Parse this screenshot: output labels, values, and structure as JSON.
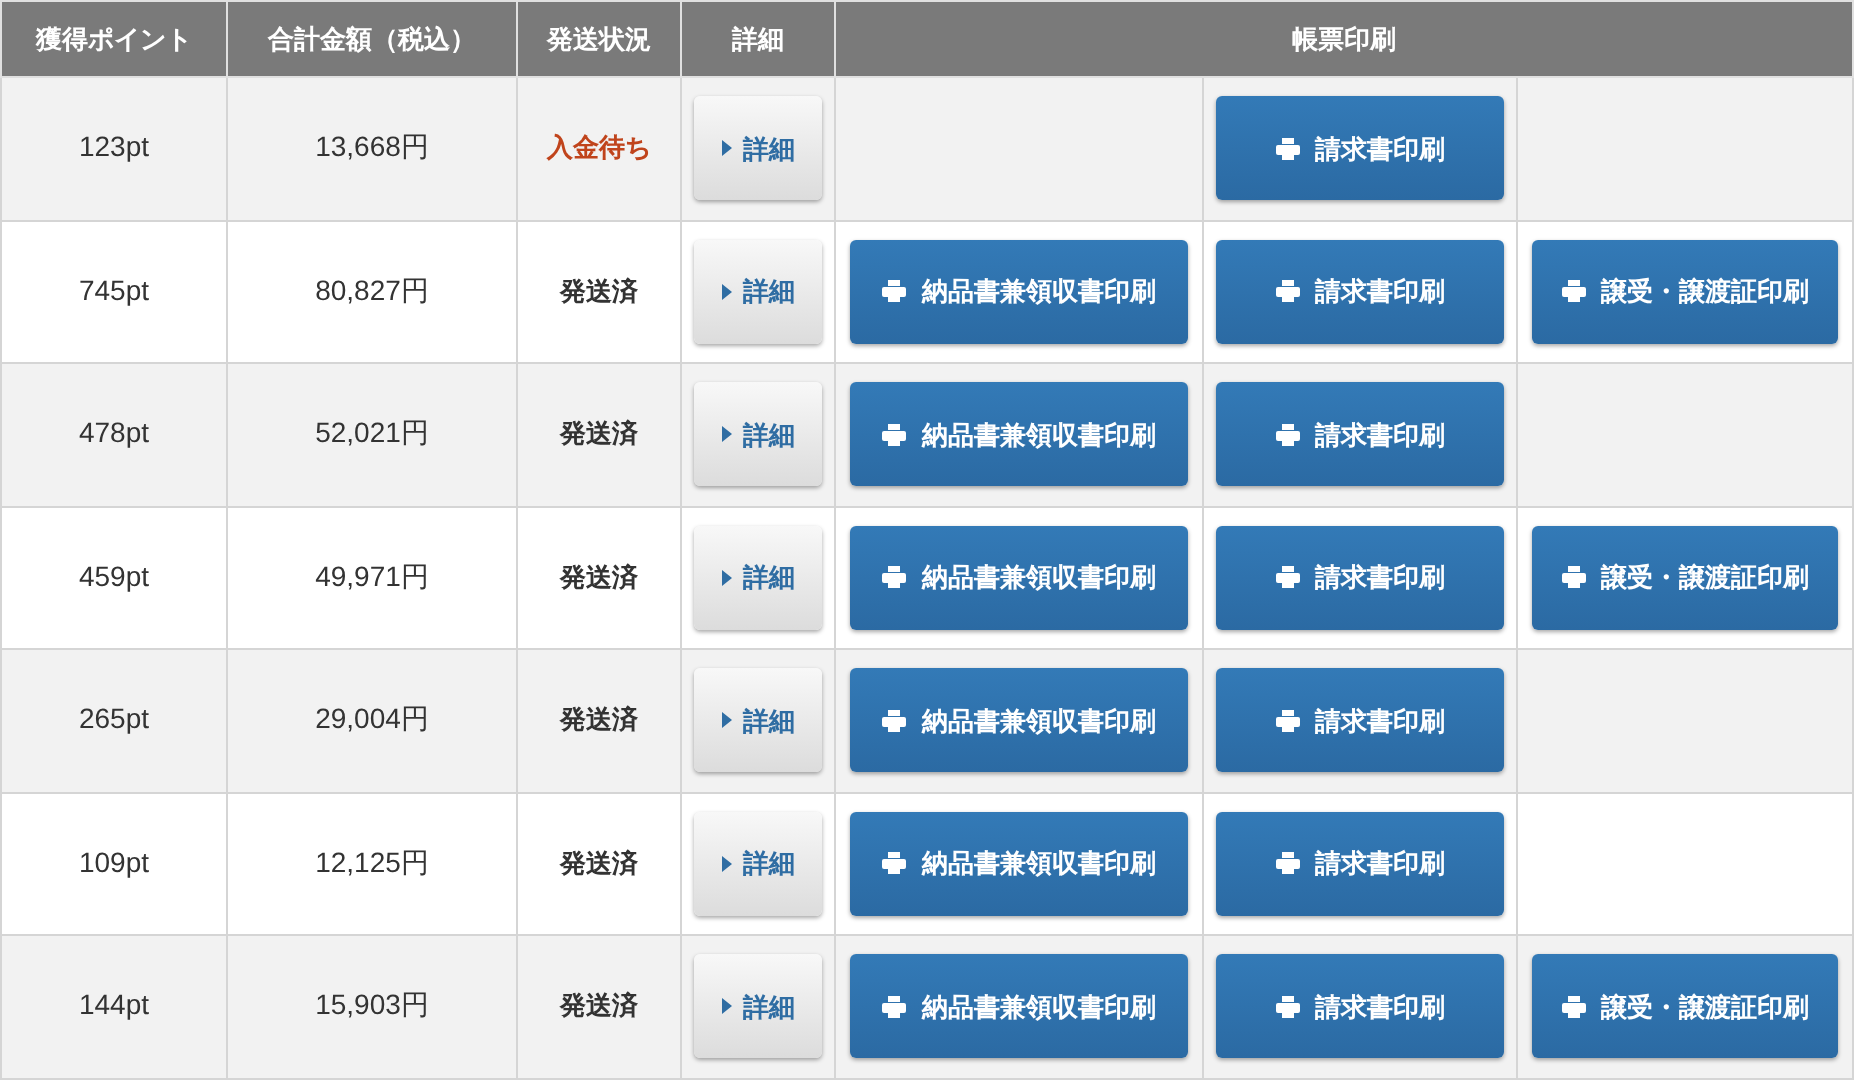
{
  "table": {
    "columns": [
      "獲得ポイント",
      "合計金額（税込）",
      "発送状況",
      "詳細",
      "帳票印刷"
    ],
    "rows": [
      {
        "points": "123pt",
        "total": "13,668円",
        "status": {
          "kind": "awaiting",
          "text": "入金待ち"
        },
        "detail": "詳細",
        "prints": [
          {
            "kind": "invoice",
            "label": "請求書印刷"
          }
        ]
      },
      {
        "points": "745pt",
        "total": "80,827円",
        "status": {
          "kind": "shipped",
          "text": "発送済"
        },
        "detail": "詳細",
        "prints": [
          {
            "kind": "delivery",
            "label": "納品書兼領収書印刷"
          },
          {
            "kind": "invoice",
            "label": "請求書印刷"
          },
          {
            "kind": "transfer",
            "label": "譲受・譲渡証印刷"
          }
        ]
      },
      {
        "points": "478pt",
        "total": "52,021円",
        "status": {
          "kind": "shipped",
          "text": "発送済"
        },
        "detail": "詳細",
        "prints": [
          {
            "kind": "delivery",
            "label": "納品書兼領収書印刷"
          },
          {
            "kind": "invoice",
            "label": "請求書印刷"
          }
        ]
      },
      {
        "points": "459pt",
        "total": "49,971円",
        "status": {
          "kind": "shipped",
          "text": "発送済"
        },
        "detail": "詳細",
        "prints": [
          {
            "kind": "delivery",
            "label": "納品書兼領収書印刷"
          },
          {
            "kind": "invoice",
            "label": "請求書印刷"
          },
          {
            "kind": "transfer",
            "label": "譲受・譲渡証印刷"
          }
        ]
      },
      {
        "points": "265pt",
        "total": "29,004円",
        "status": {
          "kind": "shipped",
          "text": "発送済"
        },
        "detail": "詳細",
        "prints": [
          {
            "kind": "delivery",
            "label": "納品書兼領収書印刷"
          },
          {
            "kind": "invoice",
            "label": "請求書印刷"
          }
        ]
      },
      {
        "points": "109pt",
        "total": "12,125円",
        "status": {
          "kind": "shipped",
          "text": "発送済"
        },
        "detail": "詳細",
        "prints": [
          {
            "kind": "delivery",
            "label": "納品書兼領収書印刷"
          },
          {
            "kind": "invoice",
            "label": "請求書印刷"
          }
        ]
      },
      {
        "points": "144pt",
        "total": "15,903円",
        "status": {
          "kind": "shipped",
          "text": "発送済"
        },
        "detail": "詳細",
        "prints": [
          {
            "kind": "delivery",
            "label": "納品書兼領収書印刷"
          },
          {
            "kind": "invoice",
            "label": "請求書印刷"
          },
          {
            "kind": "transfer",
            "label": "譲受・譲渡証印刷"
          }
        ]
      }
    ]
  }
}
